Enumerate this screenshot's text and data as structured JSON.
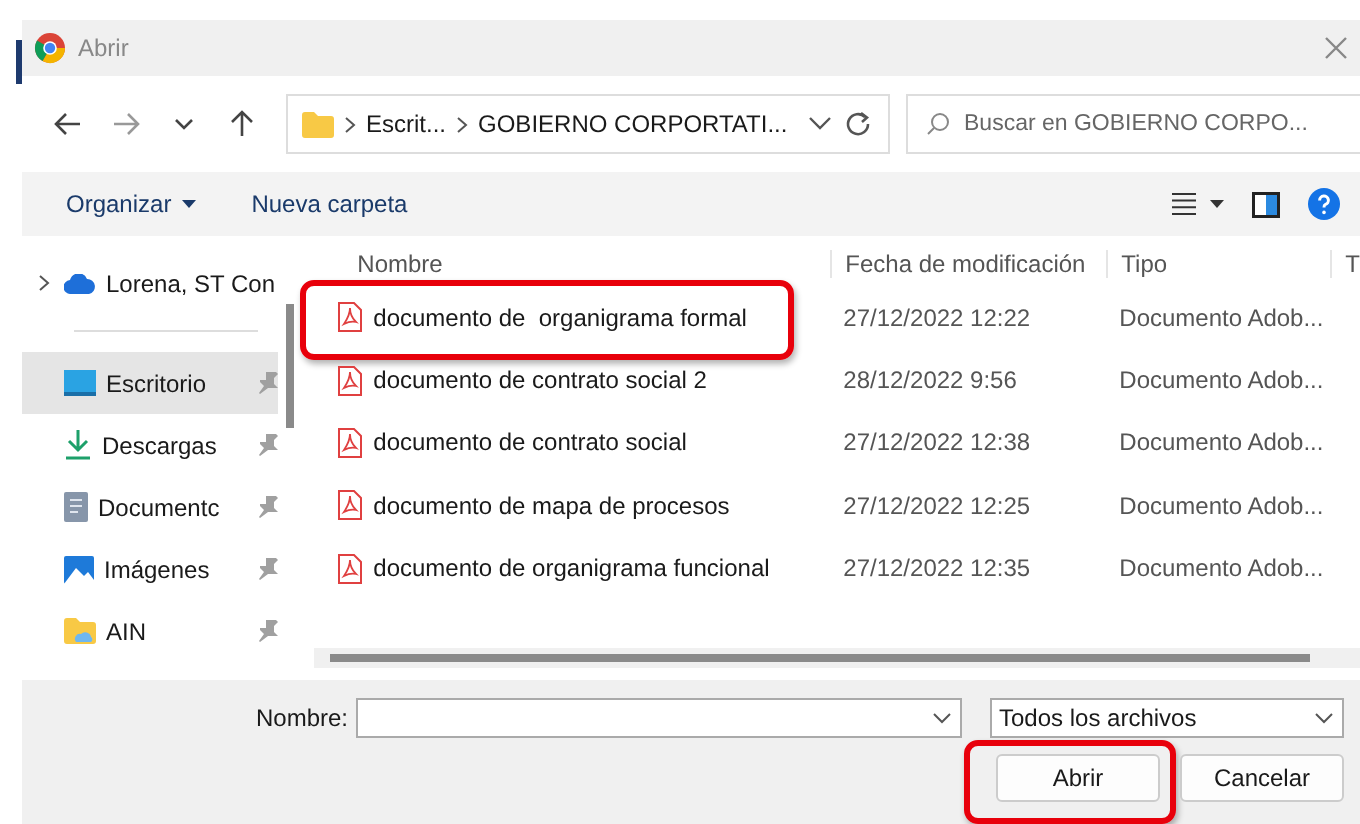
{
  "window": {
    "title": "Abrir"
  },
  "address": {
    "segments": [
      "Escrit...",
      "GOBIERNO CORPORTATI..."
    ]
  },
  "search": {
    "placeholder": "Buscar en GOBIERNO CORPO..."
  },
  "toolbar": {
    "organize": "Organizar",
    "new_folder": "Nueva carpeta"
  },
  "sidebar": {
    "items": [
      {
        "label": "Lorena, ST Con",
        "kind": "cloud",
        "expandable": true,
        "pinned": false,
        "selected": false
      },
      {
        "label": "Escritorio",
        "kind": "desktop",
        "expandable": false,
        "pinned": true,
        "selected": true
      },
      {
        "label": "Descargas",
        "kind": "download",
        "expandable": false,
        "pinned": true,
        "selected": false
      },
      {
        "label": "Documentc",
        "kind": "document",
        "expandable": false,
        "pinned": true,
        "selected": false
      },
      {
        "label": "Imágenes",
        "kind": "image",
        "expandable": false,
        "pinned": true,
        "selected": false
      },
      {
        "label": "AIN",
        "kind": "folder",
        "expandable": false,
        "pinned": true,
        "selected": false
      }
    ]
  },
  "table": {
    "columns": [
      "Nombre",
      "Fecha de modificación",
      "Tipo",
      "T"
    ],
    "rows": [
      {
        "name": "documento de  organigrama formal",
        "date": "27/12/2022 12:22",
        "type": "Documento Adob...",
        "highlighted": true
      },
      {
        "name": "documento de contrato social 2",
        "date": "28/12/2022 9:56",
        "type": "Documento Adob...",
        "highlighted": false
      },
      {
        "name": "documento de contrato social",
        "date": "27/12/2022 12:38",
        "type": "Documento Adob...",
        "highlighted": false
      },
      {
        "name": "documento de mapa de procesos",
        "date": "27/12/2022 12:25",
        "type": "Documento Adob...",
        "highlighted": false
      },
      {
        "name": "documento de organigrama funcional",
        "date": "27/12/2022 12:35",
        "type": "Documento Adob...",
        "highlighted": false
      }
    ]
  },
  "filename": {
    "label": "Nombre:"
  },
  "filter": {
    "value": "Todos los archivos"
  },
  "buttons": [
    {
      "label": "Abrir",
      "highlighted": true
    },
    {
      "label": "Cancelar",
      "highlighted": false
    }
  ]
}
